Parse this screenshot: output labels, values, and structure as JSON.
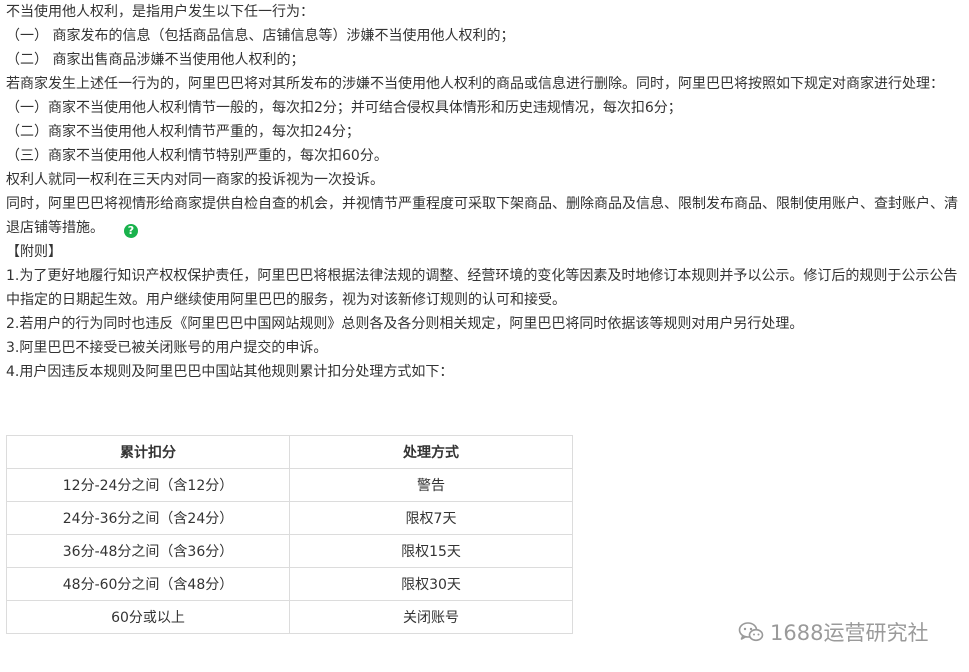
{
  "document": {
    "lines": [
      "不当使用他人权利，是指用户发生以下任一行为：",
      "（一） 商家发布的信息（包括商品信息、店铺信息等）涉嫌不当使用他人权利的；",
      "（二） 商家出售商品涉嫌不当使用他人权利的；",
      "若商家发生上述任一行为的，阿里巴巴将对其所发布的涉嫌不当使用他人权利的商品或信息进行删除。同时，阿里巴巴将按照如下规定对商家进行处理：",
      "（一）商家不当使用他人权利情节一般的，每次扣2分；并可结合侵权具体情形和历史违规情况，每次扣6分；",
      "（二）商家不当使用他人权利情节严重的，每次扣24分；",
      "（三）商家不当使用他人权利情节特别严重的，每次扣60分。",
      "权利人就同一权利在三天内对同一商家的投诉视为一次投诉。",
      "同时，阿里巴巴将视情形给商家提供自检自查的机会，并视情节严重程度可采取下架商品、删除商品及信息、限制发布商品、限制使用账户、查封账户、清退店铺等措施。",
      "【附则】",
      "1.为了更好地履行知识产权权保护责任，阿里巴巴将根据法律法规的调整、经营环境的变化等因素及时地修订本规则并予以公示。修订后的规则于公示公告中指定的日期起生效。用户继续使用阿里巴巴的服务，视为对该新修订规则的认可和接受。",
      "2.若用户的行为同时也违反《阿里巴巴中国网站规则》总则各及各分则相关规定，阿里巴巴将同时依据该等规则对用户另行处理。",
      "3.阿里巴巴不接受已被关闭账号的用户提交的申诉。",
      "4.用户因违反本规则及阿里巴巴中国站其他规则累计扣分处理方式如下："
    ],
    "help_icon": "?"
  },
  "table": {
    "headers": [
      "累计扣分",
      "处理方式"
    ],
    "rows": [
      [
        "12分-24分之间（含12分）",
        "警告"
      ],
      [
        "24分-36分之间（含24分）",
        "限权7天"
      ],
      [
        "36分-48分之间（含36分）",
        "限权15天"
      ],
      [
        "48分-60分之间（含48分）",
        "限权30天"
      ],
      [
        "60分或以上",
        "关闭账号"
      ]
    ]
  },
  "watermark": {
    "text": "1688运营研究社",
    "icon": "wechat-icon"
  },
  "colors": {
    "text": "#333333",
    "help_icon": "#19b24c",
    "border": "#dcdcdc",
    "watermark": "#9a9a9a"
  }
}
